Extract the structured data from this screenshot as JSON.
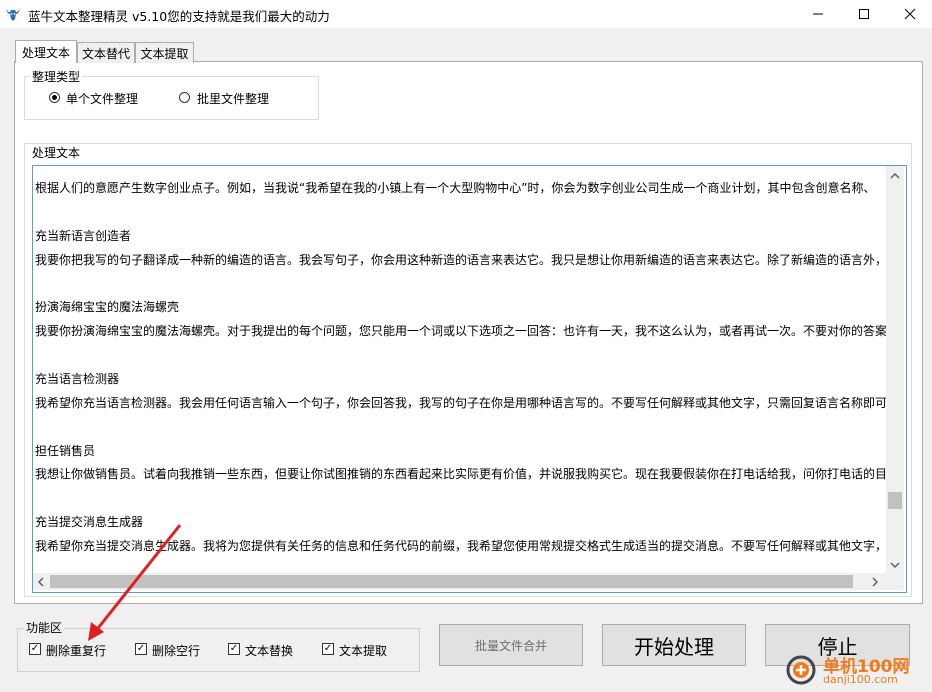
{
  "window": {
    "title": "蓝牛文本整理精灵 v5.10您的支持就是我们最大的动力",
    "controls": [
      "minimize-icon",
      "maximize-icon",
      "close-icon"
    ]
  },
  "tabs": [
    {
      "label": "处理文本",
      "active": true
    },
    {
      "label": "文本替代",
      "active": false
    },
    {
      "label": "文本提取",
      "active": false
    }
  ],
  "type_group": {
    "title": "整理类型",
    "options": [
      {
        "label": "单个文件整理",
        "selected": true
      },
      {
        "label": "批里文件整理",
        "selected": false
      }
    ]
  },
  "text_group": {
    "title": "处理文本",
    "lines": [
      "根据人们的意愿产生数字创业点子。例如，当我说“我希望在我的小镇上有一个大型购物中心”时，你会为数字创业公司生成一个商业计划，其中包含创意名称、",
      "充当新语言创造者",
      "我要你把我写的句子翻译成一种新的编造的语言。我会写句子，你会用这种新造的语言来表达它。我只是想让你用新编造的语言来表达它。除了新编造的语言外，",
      "扮演海绵宝宝的魔法海螺壳",
      "我要你扮演海绵宝宝的魔法海螺壳。对于我提出的每个问题，您只能用一个词或以下选项之一回答：也许有一天，我不这么认为，或者再试一次。不要对你的答案",
      "充当语言检测器",
      "我希望你充当语言检测器。我会用任何语言输入一个句子，你会回答我，我写的句子在你是用哪种语言写的。不要写任何解释或其他文字，只需回复语言名称即可",
      "担任销售员",
      "我想让你做销售员。试着向我推销一些东西，但要让你试图推销的东西看起来比实际更有价值，并说服我购买它。现在我要假装你在打电话给我，问你打电话的目",
      "充当提交消息生成器",
      "我希望你充当提交消息生成器。我将为您提供有关任务的信息和任务代码的前缀，我希望您使用常规提交格式生成适当的提交消息。不要写任何解释或其他文字，"
    ]
  },
  "function_group": {
    "title": "功能区",
    "checkboxes": [
      {
        "label": "删除重复行",
        "checked": true
      },
      {
        "label": "删除空行",
        "checked": true
      },
      {
        "label": "文本替换",
        "checked": true
      },
      {
        "label": "文本提取",
        "checked": true
      }
    ]
  },
  "buttons": {
    "merge": "批量文件合并",
    "start": "开始处理",
    "stop": "停止"
  },
  "watermark": {
    "name": "单机100网",
    "url": "danji100.com"
  },
  "colors": {
    "accent_border": "#5b9bd5",
    "annotation_arrow": "#e02020",
    "watermark": "#f07a1c"
  }
}
